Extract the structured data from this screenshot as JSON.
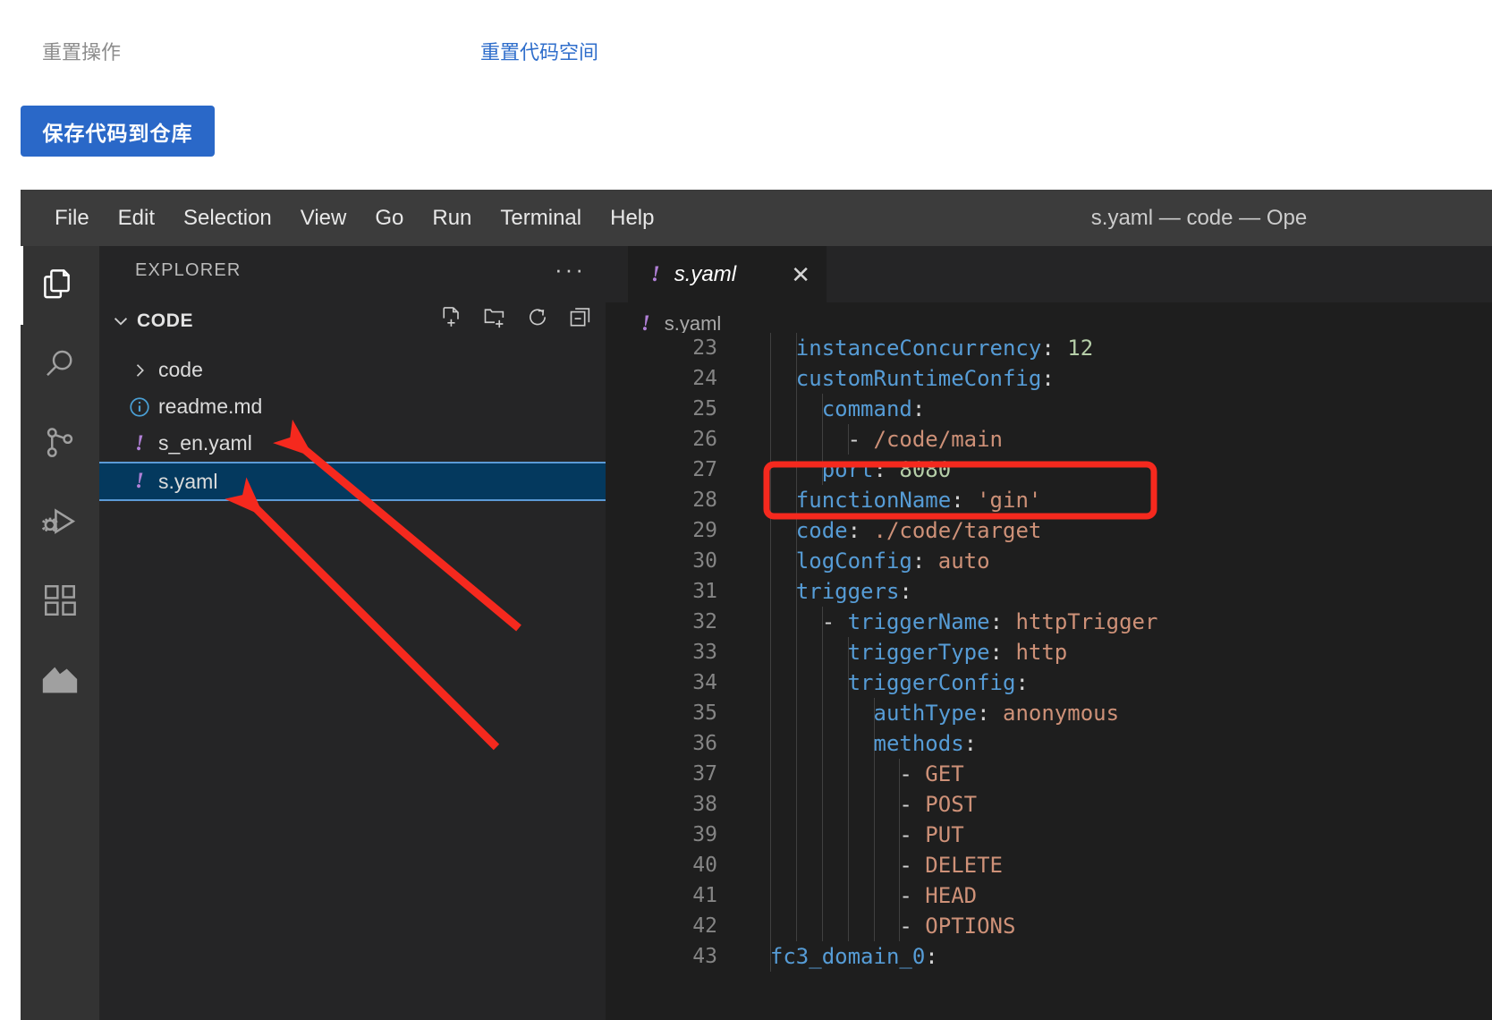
{
  "web_panel": {
    "reset_operation_label": "重置操作",
    "reset_workspace_link": "重置代码空间",
    "save_code_button": "保存代码到仓库",
    "link_color": "#2f6ecb",
    "button_color": "#2a68c8"
  },
  "vscode": {
    "menubar": {
      "items": [
        "File",
        "Edit",
        "Selection",
        "View",
        "Go",
        "Run",
        "Terminal",
        "Help"
      ]
    },
    "window_title": "s.yaml — code — Ope",
    "activity_bar": {
      "items": [
        {
          "name": "explorer-icon",
          "active": true
        },
        {
          "name": "search-icon",
          "active": false
        },
        {
          "name": "source-control-icon",
          "active": false
        },
        {
          "name": "run-and-debug-icon",
          "active": false
        },
        {
          "name": "extensions-icon",
          "active": false
        },
        {
          "name": "serverless-devs-logo-icon",
          "active": false
        }
      ]
    },
    "sidebar": {
      "title": "EXPLORER",
      "more_actions": "···",
      "folder": {
        "name": "CODE",
        "expanded": true,
        "tools": [
          "new-file-icon",
          "new-folder-icon",
          "refresh-icon",
          "collapse-all-icon"
        ]
      },
      "files": [
        {
          "label": "code",
          "icon": "chevron-right-icon",
          "type": "folder",
          "selected": false
        },
        {
          "label": "readme.md",
          "icon": "info-circle-icon",
          "type": "file",
          "selected": false
        },
        {
          "label": "s_en.yaml",
          "icon": "yaml-icon",
          "type": "file",
          "selected": false
        },
        {
          "label": "s.yaml",
          "icon": "yaml-icon",
          "type": "file",
          "selected": true
        }
      ]
    },
    "editor": {
      "tab": {
        "label": "s.yaml",
        "icon": "yaml-icon",
        "close": "✕",
        "preview": true
      },
      "breadcrumb": {
        "label": "s.yaml",
        "icon": "yaml-icon"
      },
      "lines": [
        {
          "num": "23",
          "tokens": [
            {
              "t": "    ",
              "c": "p"
            },
            {
              "t": "instanceConcurrency",
              "c": "k"
            },
            {
              "t": ": ",
              "c": "p"
            },
            {
              "t": "12",
              "c": "n"
            }
          ]
        },
        {
          "num": "24",
          "tokens": [
            {
              "t": "    ",
              "c": "p"
            },
            {
              "t": "customRuntimeConfig",
              "c": "k"
            },
            {
              "t": ":",
              "c": "p"
            }
          ]
        },
        {
          "num": "25",
          "tokens": [
            {
              "t": "      ",
              "c": "p"
            },
            {
              "t": "command",
              "c": "k"
            },
            {
              "t": ":",
              "c": "p"
            }
          ]
        },
        {
          "num": "26",
          "tokens": [
            {
              "t": "        ",
              "c": "p"
            },
            {
              "t": "- ",
              "c": "d"
            },
            {
              "t": "/code/main",
              "c": "s"
            }
          ]
        },
        {
          "num": "27",
          "tokens": [
            {
              "t": "      ",
              "c": "p"
            },
            {
              "t": "port",
              "c": "k"
            },
            {
              "t": ": ",
              "c": "p"
            },
            {
              "t": "8080",
              "c": "n"
            }
          ]
        },
        {
          "num": "28",
          "tokens": [
            {
              "t": "    ",
              "c": "p"
            },
            {
              "t": "functionName",
              "c": "k"
            },
            {
              "t": ": ",
              "c": "p"
            },
            {
              "t": "'gin'",
              "c": "s"
            }
          ]
        },
        {
          "num": "29",
          "tokens": [
            {
              "t": "    ",
              "c": "p"
            },
            {
              "t": "code",
              "c": "k"
            },
            {
              "t": ": ",
              "c": "p"
            },
            {
              "t": "./code/target",
              "c": "s"
            }
          ]
        },
        {
          "num": "30",
          "tokens": [
            {
              "t": "    ",
              "c": "p"
            },
            {
              "t": "logConfig",
              "c": "k"
            },
            {
              "t": ": ",
              "c": "p"
            },
            {
              "t": "auto",
              "c": "s"
            }
          ]
        },
        {
          "num": "31",
          "tokens": [
            {
              "t": "    ",
              "c": "p"
            },
            {
              "t": "triggers",
              "c": "k"
            },
            {
              "t": ":",
              "c": "p"
            }
          ]
        },
        {
          "num": "32",
          "tokens": [
            {
              "t": "      ",
              "c": "p"
            },
            {
              "t": "- ",
              "c": "d"
            },
            {
              "t": "triggerName",
              "c": "k"
            },
            {
              "t": ": ",
              "c": "p"
            },
            {
              "t": "httpTrigger",
              "c": "s"
            }
          ]
        },
        {
          "num": "33",
          "tokens": [
            {
              "t": "        ",
              "c": "p"
            },
            {
              "t": "triggerType",
              "c": "k"
            },
            {
              "t": ": ",
              "c": "p"
            },
            {
              "t": "http",
              "c": "s"
            }
          ]
        },
        {
          "num": "34",
          "tokens": [
            {
              "t": "        ",
              "c": "p"
            },
            {
              "t": "triggerConfig",
              "c": "k"
            },
            {
              "t": ":",
              "c": "p"
            }
          ]
        },
        {
          "num": "35",
          "tokens": [
            {
              "t": "          ",
              "c": "p"
            },
            {
              "t": "authType",
              "c": "k"
            },
            {
              "t": ": ",
              "c": "p"
            },
            {
              "t": "anonymous",
              "c": "s"
            }
          ]
        },
        {
          "num": "36",
          "tokens": [
            {
              "t": "          ",
              "c": "p"
            },
            {
              "t": "methods",
              "c": "k"
            },
            {
              "t": ":",
              "c": "p"
            }
          ]
        },
        {
          "num": "37",
          "tokens": [
            {
              "t": "            ",
              "c": "p"
            },
            {
              "t": "- ",
              "c": "d"
            },
            {
              "t": "GET",
              "c": "s"
            }
          ]
        },
        {
          "num": "38",
          "tokens": [
            {
              "t": "            ",
              "c": "p"
            },
            {
              "t": "- ",
              "c": "d"
            },
            {
              "t": "POST",
              "c": "s"
            }
          ]
        },
        {
          "num": "39",
          "tokens": [
            {
              "t": "            ",
              "c": "p"
            },
            {
              "t": "- ",
              "c": "d"
            },
            {
              "t": "PUT",
              "c": "s"
            }
          ]
        },
        {
          "num": "40",
          "tokens": [
            {
              "t": "            ",
              "c": "p"
            },
            {
              "t": "- ",
              "c": "d"
            },
            {
              "t": "DELETE",
              "c": "s"
            }
          ]
        },
        {
          "num": "41",
          "tokens": [
            {
              "t": "            ",
              "c": "p"
            },
            {
              "t": "- ",
              "c": "d"
            },
            {
              "t": "HEAD",
              "c": "s"
            }
          ]
        },
        {
          "num": "42",
          "tokens": [
            {
              "t": "            ",
              "c": "p"
            },
            {
              "t": "- ",
              "c": "d"
            },
            {
              "t": "OPTIONS",
              "c": "s"
            }
          ]
        },
        {
          "num": "43",
          "tokens": [
            {
              "t": "  ",
              "c": "p"
            },
            {
              "t": "fc3_domain_0",
              "c": "k"
            },
            {
              "t": ":",
              "c": "p"
            }
          ]
        }
      ]
    }
  },
  "annotations": {
    "highlight_color": "#f5291e",
    "highlight_rect": {
      "label": "functionName-highlight"
    },
    "arrows": [
      {
        "label": "arrow-to-s-en-yaml"
      },
      {
        "label": "arrow-to-s-yaml"
      }
    ]
  }
}
